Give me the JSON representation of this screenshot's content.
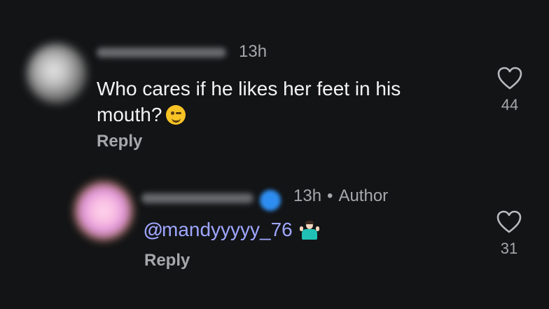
{
  "comments": [
    {
      "time": "13h",
      "text": "Who cares if he likes her feet in his mouth?",
      "emoji": "winking-face",
      "reply_label": "Reply",
      "likes": "44"
    },
    {
      "time": "13h",
      "separator": "•",
      "role": "Author",
      "mention": "mandyyyyy_76",
      "mention_icon": "threads-at-icon",
      "emoji": "person-shrugging",
      "reply_label": "Reply",
      "likes": "31"
    }
  ],
  "colors": {
    "background": "#131416",
    "text_primary": "#f4f4f4",
    "text_secondary": "#a7a8ab",
    "mention": "#9ea6ff",
    "verified": "#2e8df0"
  }
}
